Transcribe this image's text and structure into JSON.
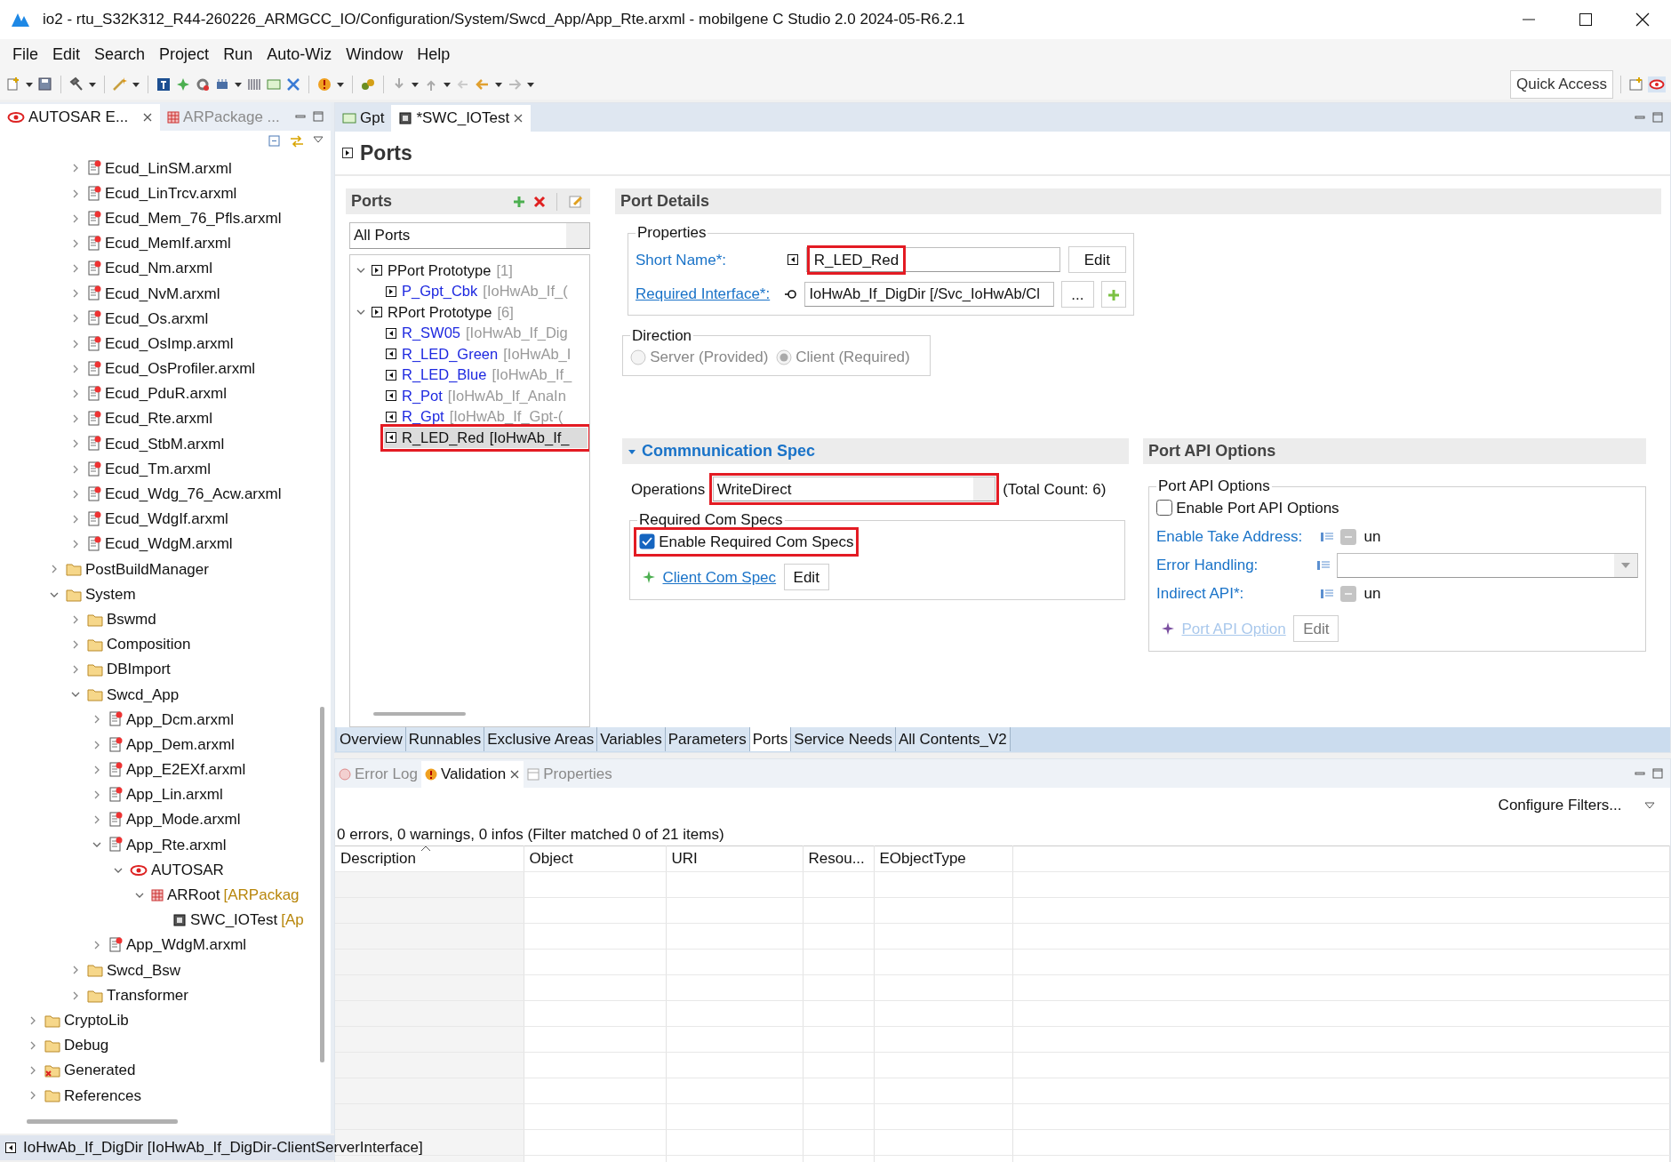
{
  "window": {
    "title": "io2 - rtu_S32K312_R44-260226_ARMGCC_IO/Configuration/System/Swcd_App/App_Rte.arxml - mobilgene C Studio 2.0 2024-05-R6.2.1"
  },
  "menu": [
    "File",
    "Edit",
    "Search",
    "Project",
    "Run",
    "Auto-Wiz",
    "Window",
    "Help"
  ],
  "toolbar": {
    "quick_access": "Quick Access"
  },
  "explorer": {
    "tabs": [
      {
        "label": "AUTOSAR E...",
        "selected": true
      },
      {
        "label": "ARPackage ...",
        "selected": false
      }
    ],
    "tree": [
      {
        "children": [
          {
            "children": [
              {
                "label": "Ecud_LinSM.arxml",
                "kind": "file",
                "expanded": false
              },
              {
                "label": "Ecud_LinTrcv.arxml",
                "kind": "file",
                "expanded": false
              },
              {
                "label": "Ecud_Mem_76_Pfls.arxml",
                "kind": "file",
                "expanded": false
              },
              {
                "label": "Ecud_MemIf.arxml",
                "kind": "file",
                "expanded": false
              },
              {
                "label": "Ecud_Nm.arxml",
                "kind": "file",
                "expanded": false
              },
              {
                "label": "Ecud_NvM.arxml",
                "kind": "file",
                "expanded": false
              },
              {
                "label": "Ecud_Os.arxml",
                "kind": "file",
                "expanded": false
              },
              {
                "label": "Ecud_OsImp.arxml",
                "kind": "file",
                "expanded": false
              },
              {
                "label": "Ecud_OsProfiler.arxml",
                "kind": "file",
                "expanded": false
              },
              {
                "label": "Ecud_PduR.arxml",
                "kind": "file",
                "expanded": false
              },
              {
                "label": "Ecud_Rte.arxml",
                "kind": "file",
                "expanded": false
              },
              {
                "label": "Ecud_StbM.arxml",
                "kind": "file",
                "expanded": false
              },
              {
                "label": "Ecud_Tm.arxml",
                "kind": "file",
                "expanded": false
              },
              {
                "label": "Ecud_Wdg_76_Acw.arxml",
                "kind": "file",
                "expanded": false
              },
              {
                "label": "Ecud_WdgIf.arxml",
                "kind": "file",
                "expanded": false
              },
              {
                "label": "Ecud_WdgM.arxml",
                "kind": "file",
                "expanded": false
              }
            ]
          },
          {
            "label": "PostBuildManager",
            "kind": "folder",
            "expanded": false
          },
          {
            "label": "System",
            "kind": "folder",
            "expanded": true,
            "children": [
              {
                "label": "Bswmd",
                "kind": "folder",
                "expanded": false
              },
              {
                "label": "Composition",
                "kind": "folder",
                "expanded": false
              },
              {
                "label": "DBImport",
                "kind": "folder",
                "expanded": false
              },
              {
                "label": "Swcd_App",
                "kind": "folder",
                "expanded": true,
                "children": [
                  {
                    "label": "App_Dcm.arxml",
                    "kind": "file",
                    "expanded": false
                  },
                  {
                    "label": "App_Dem.arxml",
                    "kind": "file",
                    "expanded": false
                  },
                  {
                    "label": "App_E2EXf.arxml",
                    "kind": "file",
                    "expanded": false
                  },
                  {
                    "label": "App_Lin.arxml",
                    "kind": "file",
                    "expanded": false
                  },
                  {
                    "label": "App_Mode.arxml",
                    "kind": "file",
                    "expanded": false
                  },
                  {
                    "label": "App_Rte.arxml",
                    "kind": "file",
                    "expanded": true,
                    "children": [
                      {
                        "label": "AUTOSAR",
                        "kind": "autosar",
                        "expanded": true,
                        "children": [
                          {
                            "label": "ARRoot",
                            "kind": "package",
                            "expanded": true,
                            "detail": "[ARPackag",
                            "children": [
                              {
                                "label": "SWC_IOTest",
                                "kind": "component",
                                "detail": "[Ap"
                              }
                            ]
                          }
                        ]
                      }
                    ]
                  },
                  {
                    "label": "App_WdgM.arxml",
                    "kind": "file",
                    "expanded": false
                  }
                ]
              },
              {
                "label": "Swcd_Bsw",
                "kind": "folder",
                "expanded": false
              },
              {
                "label": "Transformer",
                "kind": "folder",
                "expanded": false
              }
            ]
          }
        ]
      },
      {
        "label": "CryptoLib",
        "kind": "folder",
        "expanded": false
      },
      {
        "label": "Debug",
        "kind": "folder",
        "expanded": false
      },
      {
        "label": "Generated",
        "kind": "generated",
        "expanded": false
      },
      {
        "label": "References",
        "kind": "folder",
        "expanded": false
      }
    ]
  },
  "editor": {
    "tabs": [
      {
        "label": "Gpt",
        "selected": false
      },
      {
        "label": "*SWC_IOTest",
        "selected": true
      }
    ],
    "page_title": "Ports",
    "ports": {
      "title": "Ports",
      "filter": "All Ports",
      "tree": [
        {
          "label": "PPort Prototype",
          "count": "[1]",
          "expanded": true,
          "children": [
            {
              "label": "P_Gpt_Cbk",
              "detail": "[IoHwAb_If_(",
              "selected": false,
              "annotated": false
            }
          ]
        },
        {
          "label": "RPort Prototype",
          "count": "[6]",
          "expanded": true,
          "children": [
            {
              "label": "R_SW05",
              "detail": "[IoHwAb_If_Dig",
              "selected": false,
              "annotated": false
            },
            {
              "label": "R_LED_Green",
              "detail": "[IoHwAb_I",
              "selected": false,
              "annotated": false
            },
            {
              "label": "R_LED_Blue",
              "detail": "[IoHwAb_If_",
              "selected": false,
              "annotated": false
            },
            {
              "label": "R_Pot",
              "detail": "[IoHwAb_If_AnaIn",
              "selected": false,
              "annotated": false
            },
            {
              "label": "R_Gpt",
              "detail": "[IoHwAb_If_Gpt-(",
              "selected": false,
              "annotated": false
            },
            {
              "label": "R_LED_Red",
              "detail": "[IoHwAb_If_",
              "selected": true,
              "annotated": true
            }
          ]
        }
      ]
    },
    "port_details": {
      "title": "Port Details",
      "properties": {
        "legend": "Properties",
        "short_name_label": "Short Name*:",
        "short_name": "R_LED_Red",
        "short_name_annotated": true,
        "edit": "Edit",
        "interface_label": "Required Interface*:",
        "interface": "IoHwAb_If_DigDir [/Svc_IoHwAb/Cl",
        "browse": "..."
      },
      "direction": {
        "legend": "Direction",
        "disabled": true,
        "options": [
          {
            "label": "Server (Provided)",
            "selected": false
          },
          {
            "label": "Client (Required)",
            "selected": true
          }
        ]
      }
    },
    "comm_spec": {
      "title": "Commnunication Spec",
      "expanded": true,
      "operations_label": "Operations",
      "operations": "WriteDirect",
      "operations_annotated": true,
      "total": "(Total Count: 6)",
      "group": {
        "legend": "Required Com Specs",
        "checkbox": {
          "label": "Enable Required Com Specs",
          "checked": true,
          "annotated": true
        },
        "link": "Client Com Spec",
        "edit": "Edit"
      }
    },
    "port_api": {
      "title": "Port API Options",
      "legend": "Port API Options",
      "checkbox": {
        "label": "Enable Port API Options",
        "checked": false
      },
      "fields": [
        {
          "kind": "tristate",
          "label": "Enable Take Address:",
          "value": "un",
          "indeterminate": true
        },
        {
          "kind": "combo",
          "label": "Error Handling:"
        },
        {
          "kind": "tristate",
          "label": "Indirect API*:",
          "value": "un",
          "indeterminate": true
        }
      ],
      "link": "Port API Option",
      "link_disabled": true,
      "edit": "Edit"
    },
    "page_tabs": [
      {
        "label": "Overview",
        "selected": false
      },
      {
        "label": "Runnables",
        "selected": false
      },
      {
        "label": "Exclusive Areas",
        "selected": false
      },
      {
        "label": "Variables",
        "selected": false
      },
      {
        "label": "Parameters",
        "selected": false
      },
      {
        "label": "Ports",
        "selected": true
      },
      {
        "label": "Service Needs",
        "selected": false
      },
      {
        "label": "All Contents_V2",
        "selected": false
      }
    ]
  },
  "validation": {
    "tabs": [
      {
        "label": "Error Log",
        "selected": false
      },
      {
        "label": "Validation",
        "selected": true
      },
      {
        "label": "Properties",
        "selected": false
      }
    ],
    "configure": "Configure Filters...",
    "summary": "0 errors, 0 warnings, 0 infos (Filter matched 0 of 21 items)",
    "columns": [
      "Description",
      "Object",
      "URI",
      "Resou...",
      "EObjectType"
    ]
  },
  "status_bar": "IoHwAb_If_DigDir [IoHwAb_If_DigDir-ClientServerInterface]"
}
